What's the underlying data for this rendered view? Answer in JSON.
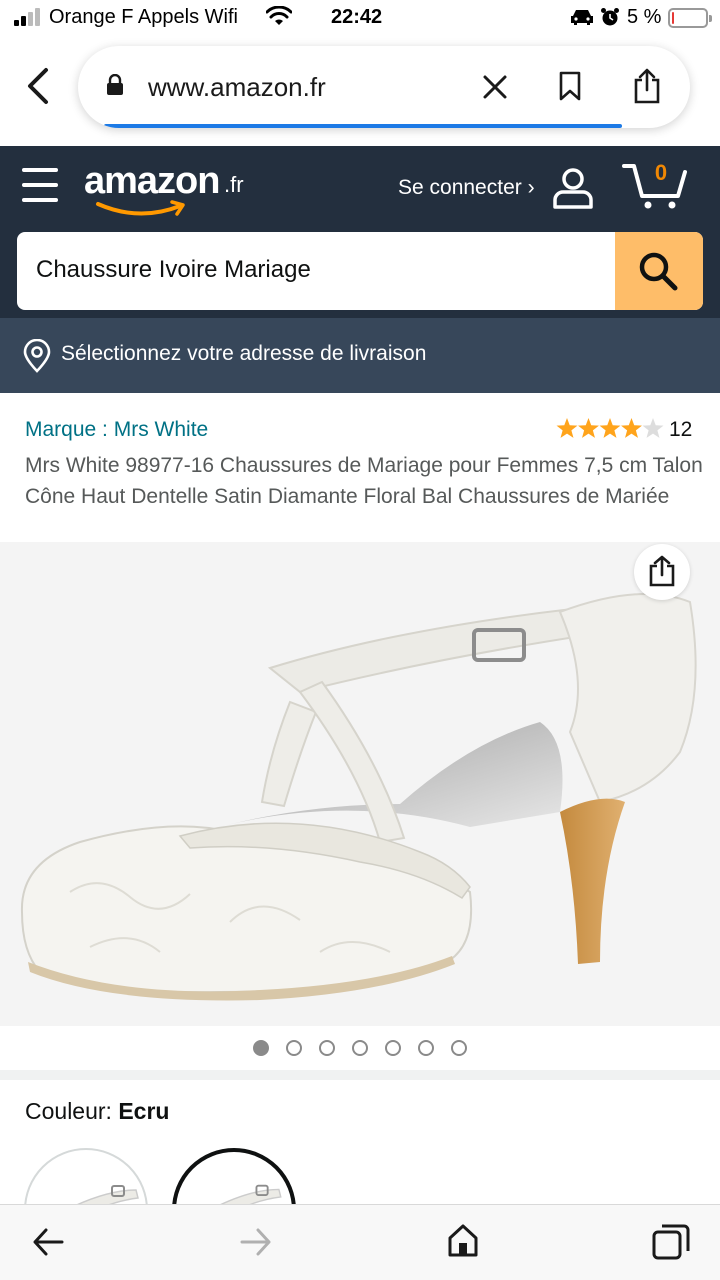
{
  "status_bar": {
    "carrier": "Orange F Appels Wifi",
    "time": "22:42",
    "battery_percent": "5 %",
    "battery_level": 0.05,
    "icons": [
      "signal-icon",
      "wifi-icon",
      "car-icon",
      "alarm-icon",
      "battery-icon"
    ]
  },
  "browser": {
    "url": "www.amazon.fr",
    "icons": [
      "back-icon",
      "lock-icon",
      "clear-icon",
      "bookmark-icon",
      "share-icon"
    ],
    "accent": "#1c7ae6"
  },
  "header": {
    "logo_word": "amazon",
    "logo_tld": ".fr",
    "signin_label": "Se connecter ›",
    "cart_count": "0",
    "search_value": "Chaussure Ivoire Mariage",
    "colors": {
      "background": "#232f3e",
      "search_button": "#febd69",
      "cart_count": "#f08804"
    }
  },
  "delivery": {
    "label": "Sélectionnez votre adresse de livraison",
    "background": "#37475a"
  },
  "product": {
    "brand_label": "Marque : Mrs White",
    "rating_value": 4,
    "rating_max": 5,
    "rating_count": "12",
    "title": "Mrs White 98977-16 Chaussures de Mariage pour Femmes 7,5 cm Talon Cône Haut Dentelle Satin Diamante Floral Bal Chaussures de Mariée",
    "image_count": 7,
    "active_image": 1,
    "color_label": "Couleur:",
    "color_value": "Ecru"
  },
  "bottom_toolbar": {
    "icons": [
      "back-arrow-icon",
      "forward-arrow-icon",
      "home-icon",
      "tabs-icon"
    ]
  }
}
